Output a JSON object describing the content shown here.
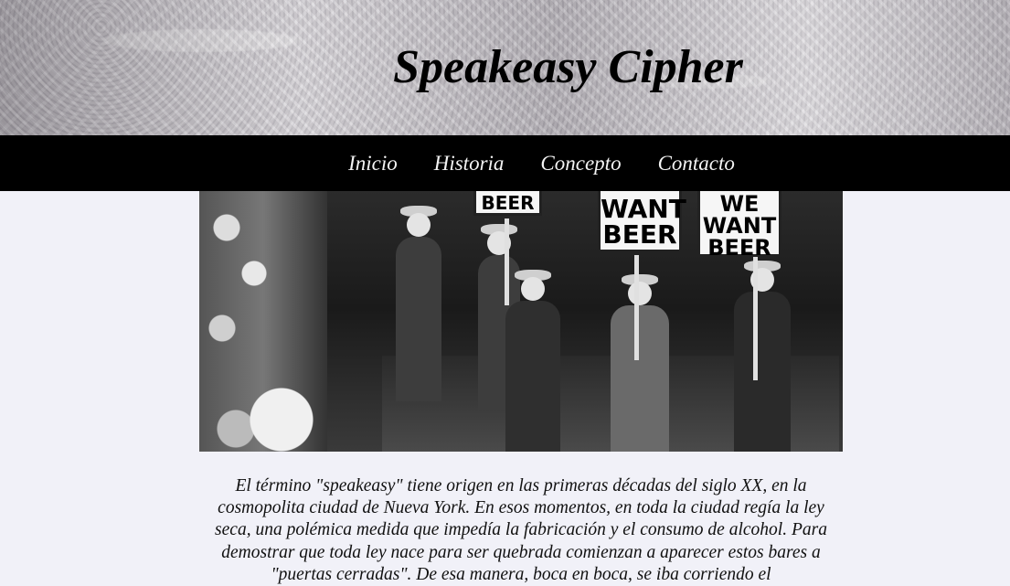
{
  "site": {
    "title": "Speakeasy Cipher"
  },
  "nav": {
    "items": [
      {
        "label": "Inicio"
      },
      {
        "label": "Historia"
      },
      {
        "label": "Concepto"
      },
      {
        "label": "Contacto"
      }
    ]
  },
  "hero": {
    "signs": [
      "BEER",
      "WANT BEER",
      "WE WANT BEER"
    ]
  },
  "intro": {
    "text": "El término \"speakeasy\" tiene origen en las primeras décadas del siglo XX, en la cosmopolita ciudad de Nueva York. En esos momentos, en toda la ciudad regía la ley seca, una polémica medida que impedía la fabricación y el consumo de alcohol. Para demostrar que toda ley nace para ser quebrada comienzan a aparecer estos bares a \"puertas cerradas\". De esa manera, boca en boca, se iba corriendo el"
  },
  "colors": {
    "navbar": "#000000",
    "page_background": "#f1f1f8",
    "nav_text": "#f4f4f4"
  }
}
